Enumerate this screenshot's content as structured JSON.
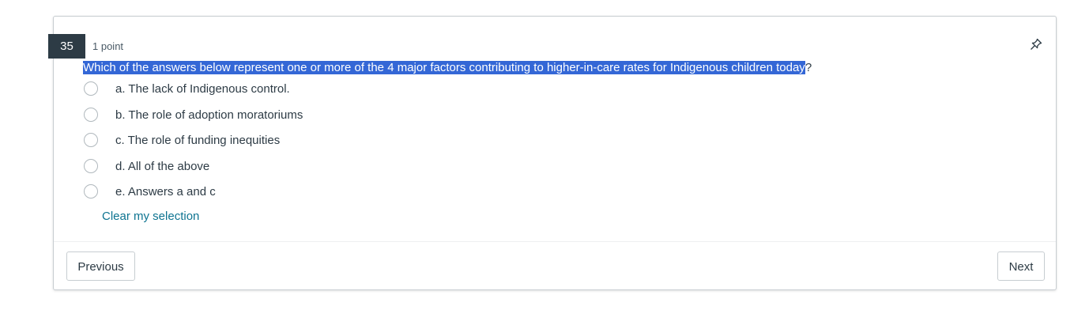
{
  "question": {
    "number": "35",
    "points": "1 point",
    "text_highlighted": "Which of the answers below represent one or more of the 4 major factors contributing to higher-in-care rates for Indigenous children today",
    "text_trailing": "?",
    "pin_icon": "pin-icon"
  },
  "answers": [
    {
      "label": "a. The lack of Indigenous control."
    },
    {
      "label": "b. The role of adoption moratoriums"
    },
    {
      "label": "c. The role of funding inequities"
    },
    {
      "label": "d. All of the above"
    },
    {
      "label": "e. Answers a and c"
    }
  ],
  "clear_selection_label": "Clear my selection",
  "navigation": {
    "previous_label": "Previous",
    "next_label": "Next"
  },
  "colors": {
    "highlight": "#3467d6",
    "badge": "#2d3b45",
    "link": "#0e7491"
  }
}
